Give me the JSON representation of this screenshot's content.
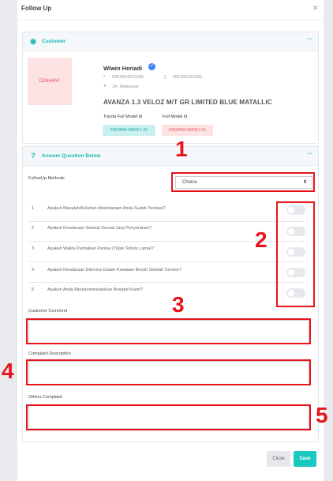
{
  "modal": {
    "title": "Follow Up",
    "close_icon": "close-icon"
  },
  "customer_section": {
    "title": "Customer",
    "plate": "DD444AY",
    "name": "Wiwin Heriadi",
    "phone1": "0987654321555",
    "phone2": "081359123580",
    "address": "Jln. Makassar",
    "car": "AVANZA 1.3 VELOZ M/T GR LIMITED BLUE MATALLIC",
    "toyota_label": "Toyota Full Model Id",
    "full_label": "Full Model Id",
    "toyota_value": "F653RM-GMSFJ 31",
    "full_value": "F653RM-GMSFJ 31"
  },
  "answer_section": {
    "title": "Answer Question Below",
    "method_label": "FollowUp Methode",
    "method_value": "Choice",
    "questions": [
      {
        "num": "1",
        "text": "Apakah Masalah/Keluhan dikendaraan Anda Sudah Teratasi?"
      },
      {
        "num": "2",
        "text": "Apakah Kendaraan Selesai Sesuai Janji Penyerahan?"
      },
      {
        "num": "3",
        "text": "Apakah Waktu Perbaikan Pantas (Tidak Terlalu Lama)?"
      },
      {
        "num": "4",
        "text": "Apakah Kendaraan Diterima Dalam Keadaan Bersih Setelah Service?"
      },
      {
        "num": "5",
        "text": "Apakah Anda Merekomendasikan Bengkel Kami?"
      }
    ],
    "customer_comment_label": "Customer Comment",
    "complaint_label": "Complaint Description",
    "others_label": "Others Complaint"
  },
  "footer": {
    "close_label": "Close",
    "save_label": "Save"
  },
  "annotations": [
    "1",
    "2",
    "3",
    "4",
    "5"
  ],
  "colors": {
    "accent": "#1bb9b4",
    "annotation": "#e8141c",
    "plate": "#e8505b"
  }
}
